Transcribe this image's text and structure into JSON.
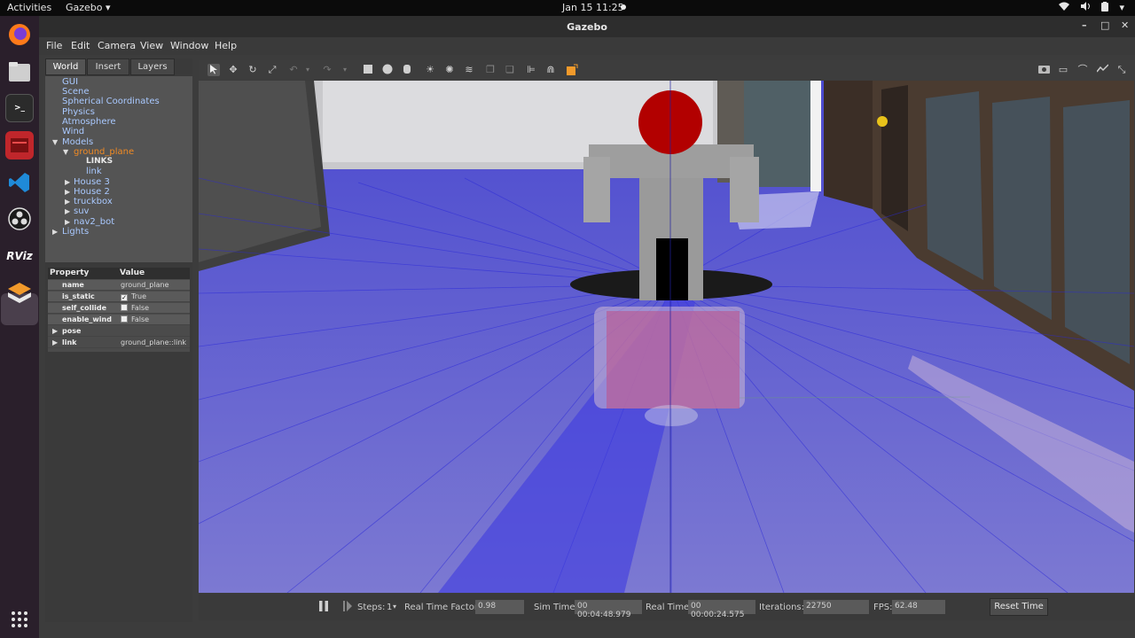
{
  "topbar": {
    "activities": "Activities",
    "app_menu": "Gazebo ▾",
    "clock": "Jan 15  11:25",
    "tray": [
      "wifi-icon",
      "sound-icon",
      "battery-icon",
      "menu-icon"
    ]
  },
  "dock": {
    "items": [
      "firefox-icon",
      "files-icon",
      "terminal-icon",
      "app-icon",
      "vscode-icon",
      "obs-icon",
      "rviz-icon",
      "gazebo-icon",
      "apps-grid-icon"
    ],
    "rviz_label": "RViz"
  },
  "window": {
    "title": "Gazebo",
    "controls": [
      "–",
      "□",
      "✕"
    ]
  },
  "menu": [
    "File",
    "Edit",
    "Camera",
    "View",
    "Window",
    "Help"
  ],
  "panel": {
    "tabs": [
      "World",
      "Insert",
      "Layers"
    ],
    "tree": {
      "gui": "GUI",
      "scene": "Scene",
      "spherical": "Spherical Coordinates",
      "physics": "Physics",
      "atmosphere": "Atmosphere",
      "wind": "Wind",
      "models": "Models",
      "ground_plane": "ground_plane",
      "links": "LINKS",
      "link": "link",
      "house3": "House 3",
      "house2": "House 2",
      "truckbox": "truckbox",
      "suv": "suv",
      "nav2_bot": "nav2_bot",
      "lights": "Lights"
    },
    "properties": {
      "header_property": "Property",
      "header_value": "Value",
      "rows": [
        {
          "key": "name",
          "value": "ground_plane"
        },
        {
          "key": "is_static",
          "value": "True",
          "checked": true
        },
        {
          "key": "self_collide",
          "value": "False",
          "checked": false
        },
        {
          "key": "enable_wind",
          "value": "False",
          "checked": false
        },
        {
          "key": "pose",
          "value": ""
        },
        {
          "key": "link",
          "value": "ground_plane::link"
        }
      ]
    }
  },
  "bottom": {
    "steps_label": "Steps:",
    "steps_value": "1",
    "rtf_label": "Real Time Factor:",
    "rtf_value": "0.98",
    "sim_label": "Sim Time:",
    "sim_value": "00 00:04:48.979",
    "real_label": "Real Time:",
    "real_value": "00 00:00:24.575",
    "iter_label": "Iterations:",
    "iter_value": "22750",
    "fps_label": "FPS:",
    "fps_value": "62.48",
    "reset_label": "Reset Time"
  },
  "colors": {
    "laser": "#3b36e6",
    "robot_sphere": "#b20000",
    "selected": "#f08a24"
  }
}
